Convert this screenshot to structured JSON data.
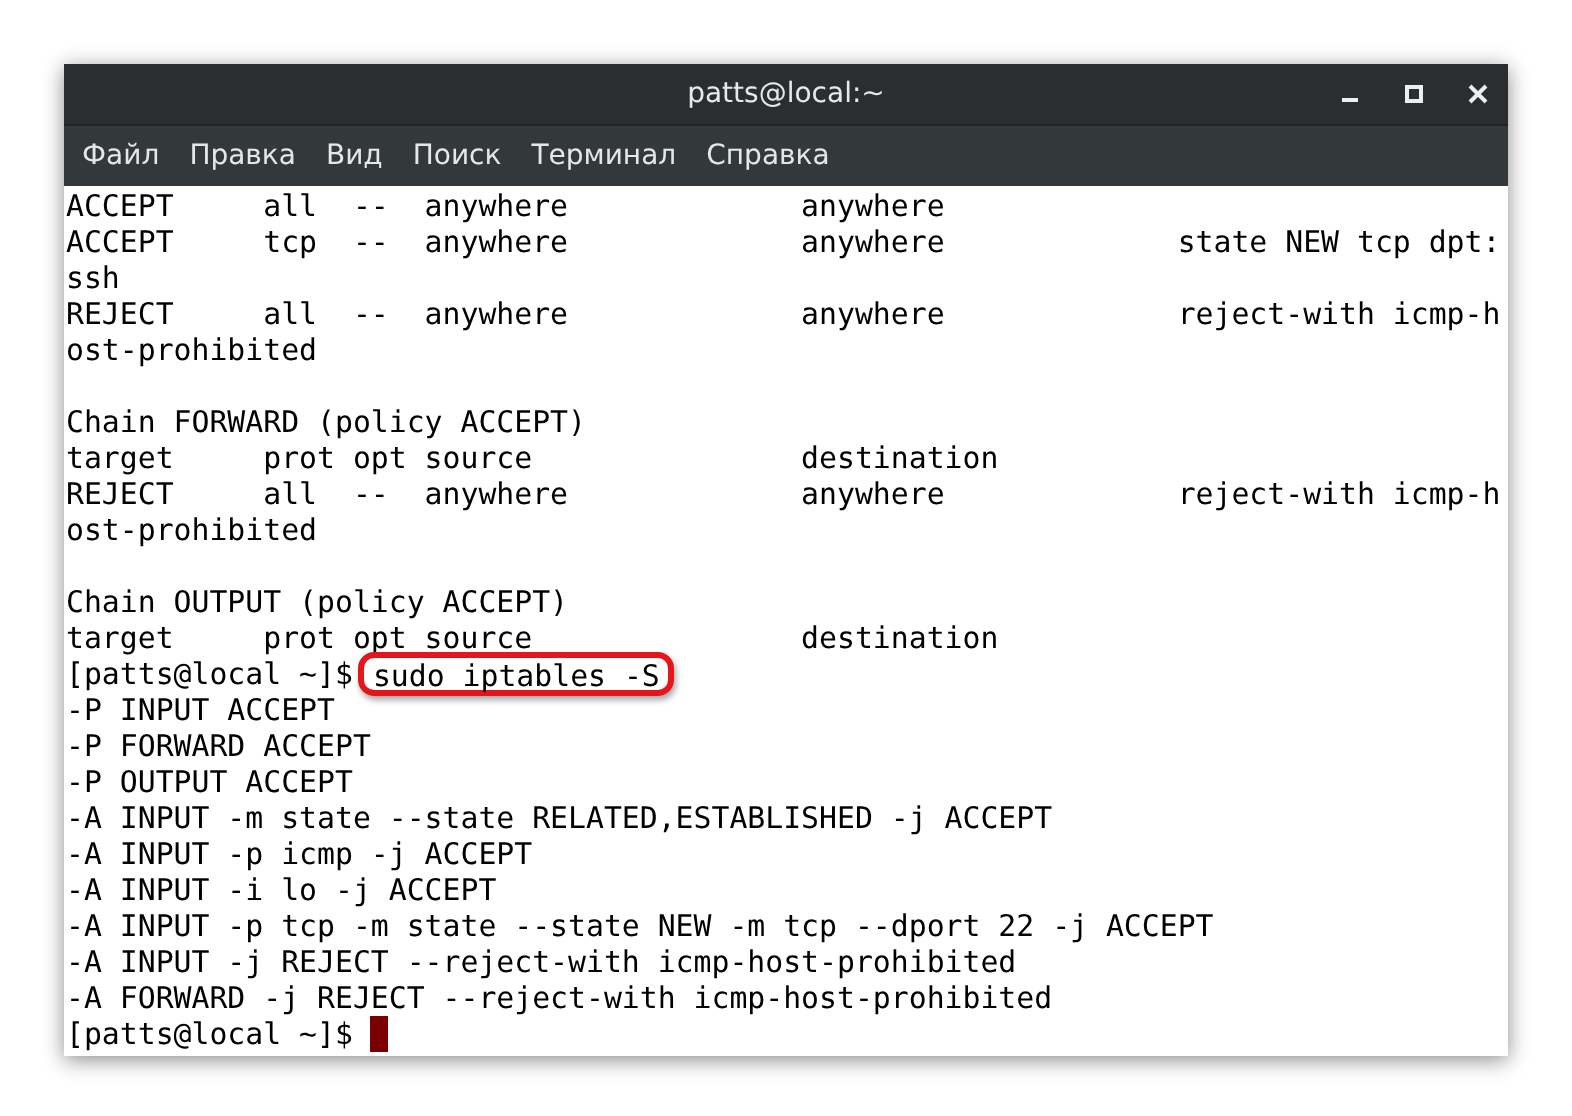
{
  "window": {
    "title": "patts@local:~"
  },
  "menu": [
    "Файл",
    "Правка",
    "Вид",
    "Поиск",
    "Терминал",
    "Справка"
  ],
  "terminal": {
    "lines": [
      {
        "kind": "output",
        "text": "ACCEPT     all  --  anywhere             anywhere"
      },
      {
        "kind": "output",
        "text": "ACCEPT     tcp  --  anywhere             anywhere             state NEW tcp dpt:"
      },
      {
        "kind": "output",
        "text": "ssh"
      },
      {
        "kind": "output",
        "text": "REJECT     all  --  anywhere             anywhere             reject-with icmp-h"
      },
      {
        "kind": "output",
        "text": "ost-prohibited"
      },
      {
        "kind": "blank"
      },
      {
        "kind": "output",
        "text": "Chain FORWARD (policy ACCEPT)"
      },
      {
        "kind": "output",
        "text": "target     prot opt source               destination"
      },
      {
        "kind": "output",
        "text": "REJECT     all  --  anywhere             anywhere             reject-with icmp-h"
      },
      {
        "kind": "output",
        "text": "ost-prohibited"
      },
      {
        "kind": "blank"
      },
      {
        "kind": "output",
        "text": "Chain OUTPUT (policy ACCEPT)"
      },
      {
        "kind": "output",
        "text": "target     prot opt source               destination"
      },
      {
        "kind": "command",
        "prompt": "[patts@local ~]$",
        "command": "sudo iptables -S",
        "highlighted": true
      },
      {
        "kind": "output",
        "text": "-P INPUT ACCEPT"
      },
      {
        "kind": "output",
        "text": "-P FORWARD ACCEPT"
      },
      {
        "kind": "output",
        "text": "-P OUTPUT ACCEPT"
      },
      {
        "kind": "output",
        "text": "-A INPUT -m state --state RELATED,ESTABLISHED -j ACCEPT"
      },
      {
        "kind": "output",
        "text": "-A INPUT -p icmp -j ACCEPT"
      },
      {
        "kind": "output",
        "text": "-A INPUT -i lo -j ACCEPT"
      },
      {
        "kind": "output",
        "text": "-A INPUT -p tcp -m state --state NEW -m tcp --dport 22 -j ACCEPT"
      },
      {
        "kind": "output",
        "text": "-A INPUT -j REJECT --reject-with icmp-host-prohibited"
      },
      {
        "kind": "output",
        "text": "-A FORWARD -j REJECT --reject-with icmp-host-prohibited"
      },
      {
        "kind": "prompt",
        "prompt": "[patts@local ~]$",
        "cursor": true
      }
    ]
  }
}
